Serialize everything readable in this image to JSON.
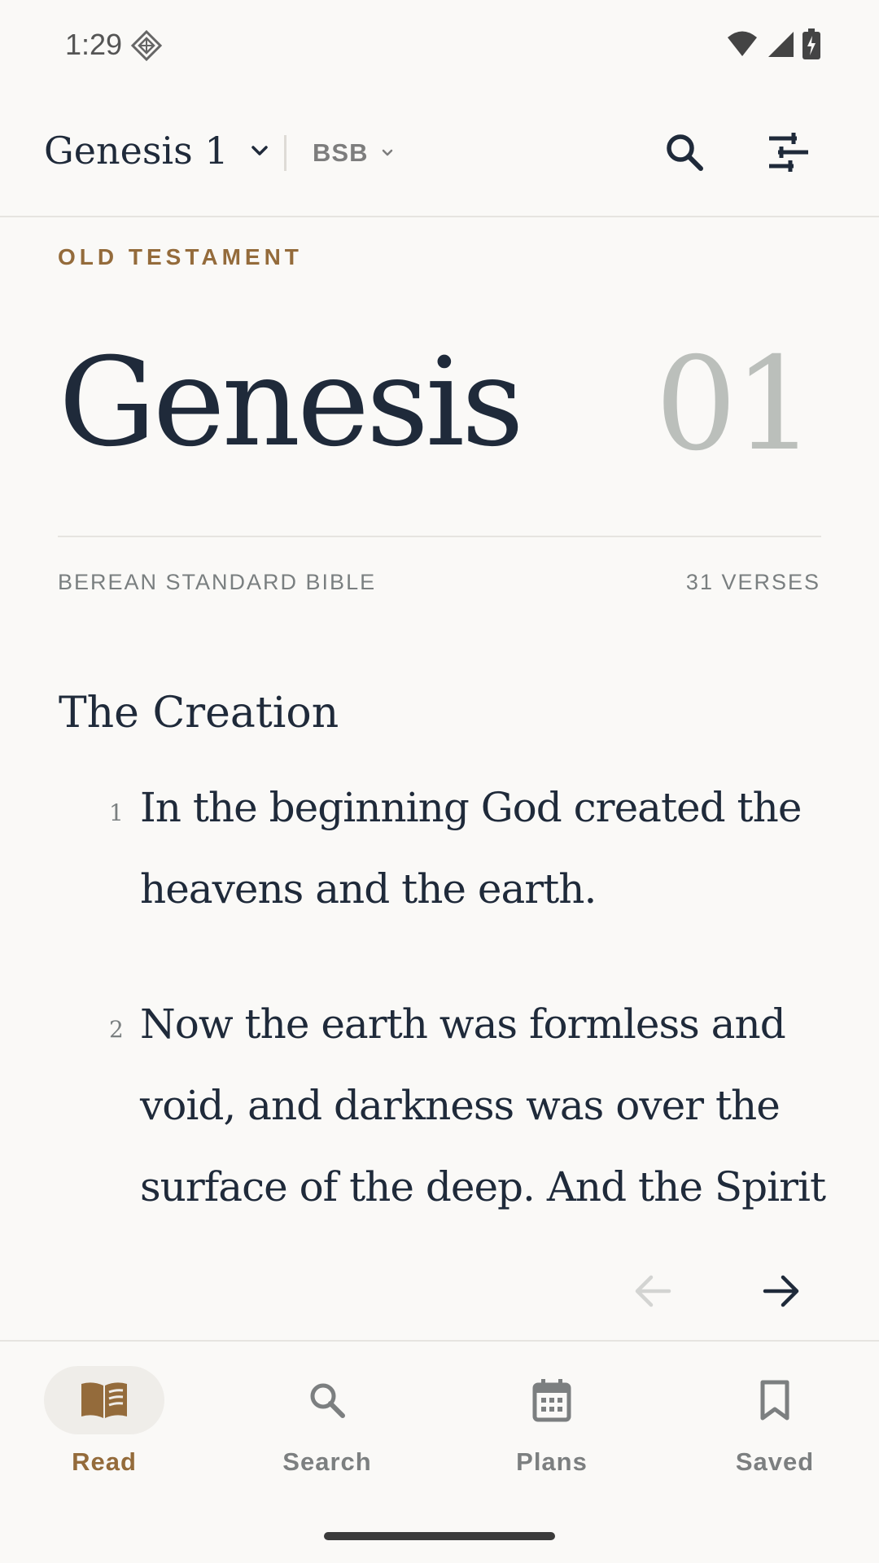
{
  "status_bar": {
    "time": "1:29",
    "icons": [
      "diamond-icon",
      "wifi-icon",
      "signal-icon",
      "battery-icon"
    ]
  },
  "app_bar": {
    "book_chapter": "Genesis 1",
    "translation": "BSB",
    "icons": [
      "chevron-down-icon",
      "search-icon",
      "tune-icon"
    ]
  },
  "chapter_header": {
    "testament": "OLD TESTAMENT",
    "book": "Genesis",
    "chapter_number": "01",
    "version_name": "BEREAN STANDARD BIBLE",
    "verse_count": "31 VERSES"
  },
  "reading": {
    "section_heading": "The Creation",
    "verses": [
      {
        "number": "1",
        "text": "In the beginning God created the heavens and the earth."
      },
      {
        "number": "2",
        "text": "Now the earth was formless and void, and darkness was over the surface of the deep. And the Spirit"
      }
    ]
  },
  "chapter_nav": {
    "icons": [
      "arrow-left-icon",
      "arrow-right-icon"
    ],
    "prev_enabled": false,
    "next_enabled": true
  },
  "bottom_nav": {
    "items": [
      {
        "label": "Read",
        "icon": "book-icon",
        "active": true
      },
      {
        "label": "Search",
        "icon": "search-icon",
        "active": false
      },
      {
        "label": "Plans",
        "icon": "calendar-icon",
        "active": false
      },
      {
        "label": "Saved",
        "icon": "bookmark-icon",
        "active": false
      }
    ]
  },
  "colors": {
    "accent": "#946b3b",
    "text": "#1f2a3a",
    "muted": "#7a7f80",
    "background": "#faf9f7"
  }
}
